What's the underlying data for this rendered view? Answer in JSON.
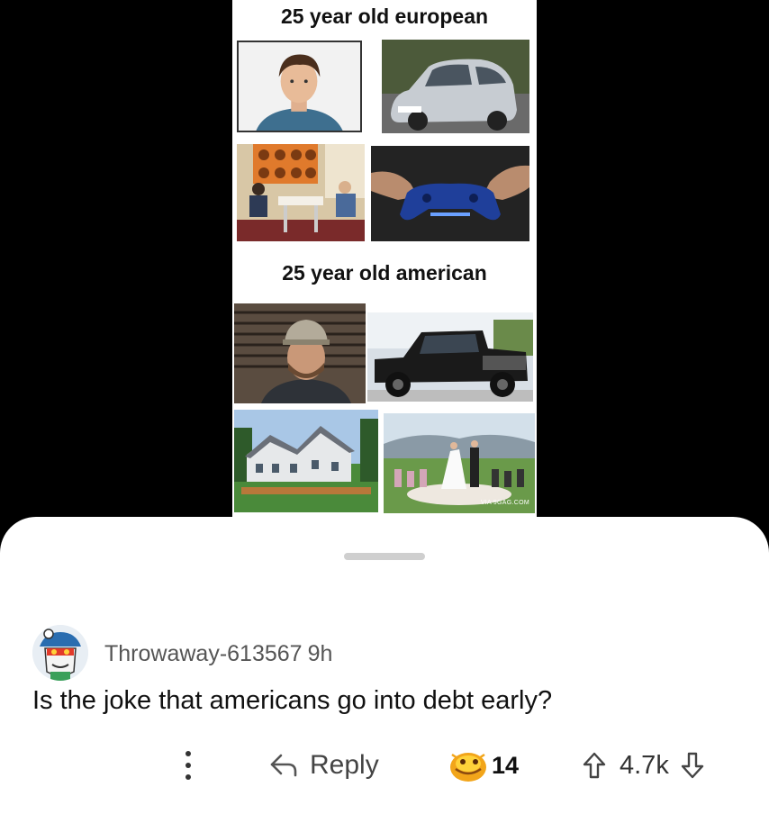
{
  "meme": {
    "heading_top": "25 year old european",
    "heading_bottom": "25 year old american",
    "watermark": "VIA 9GAG.COM",
    "photos": {
      "eu_person": "young-man-portrait",
      "eu_car": "small-silver-hatchback",
      "eu_home": "parents-kitchen",
      "eu_hobby": "game-controller",
      "us_person": "man-in-cap-portrait",
      "us_car": "black-pickup-truck",
      "us_home": "large-house",
      "us_life": "wedding-ceremony"
    }
  },
  "comment": {
    "username": "Throwaway-613567",
    "time": "9h",
    "body": "Is the joke that americans go into debt early?",
    "reply_label": "Reply",
    "award_count": "14",
    "vote_count": "4.7k"
  },
  "colors": {
    "background": "#000000",
    "sheet": "#ffffff",
    "handle": "#cfcfcf",
    "award": "#f2a51a"
  }
}
